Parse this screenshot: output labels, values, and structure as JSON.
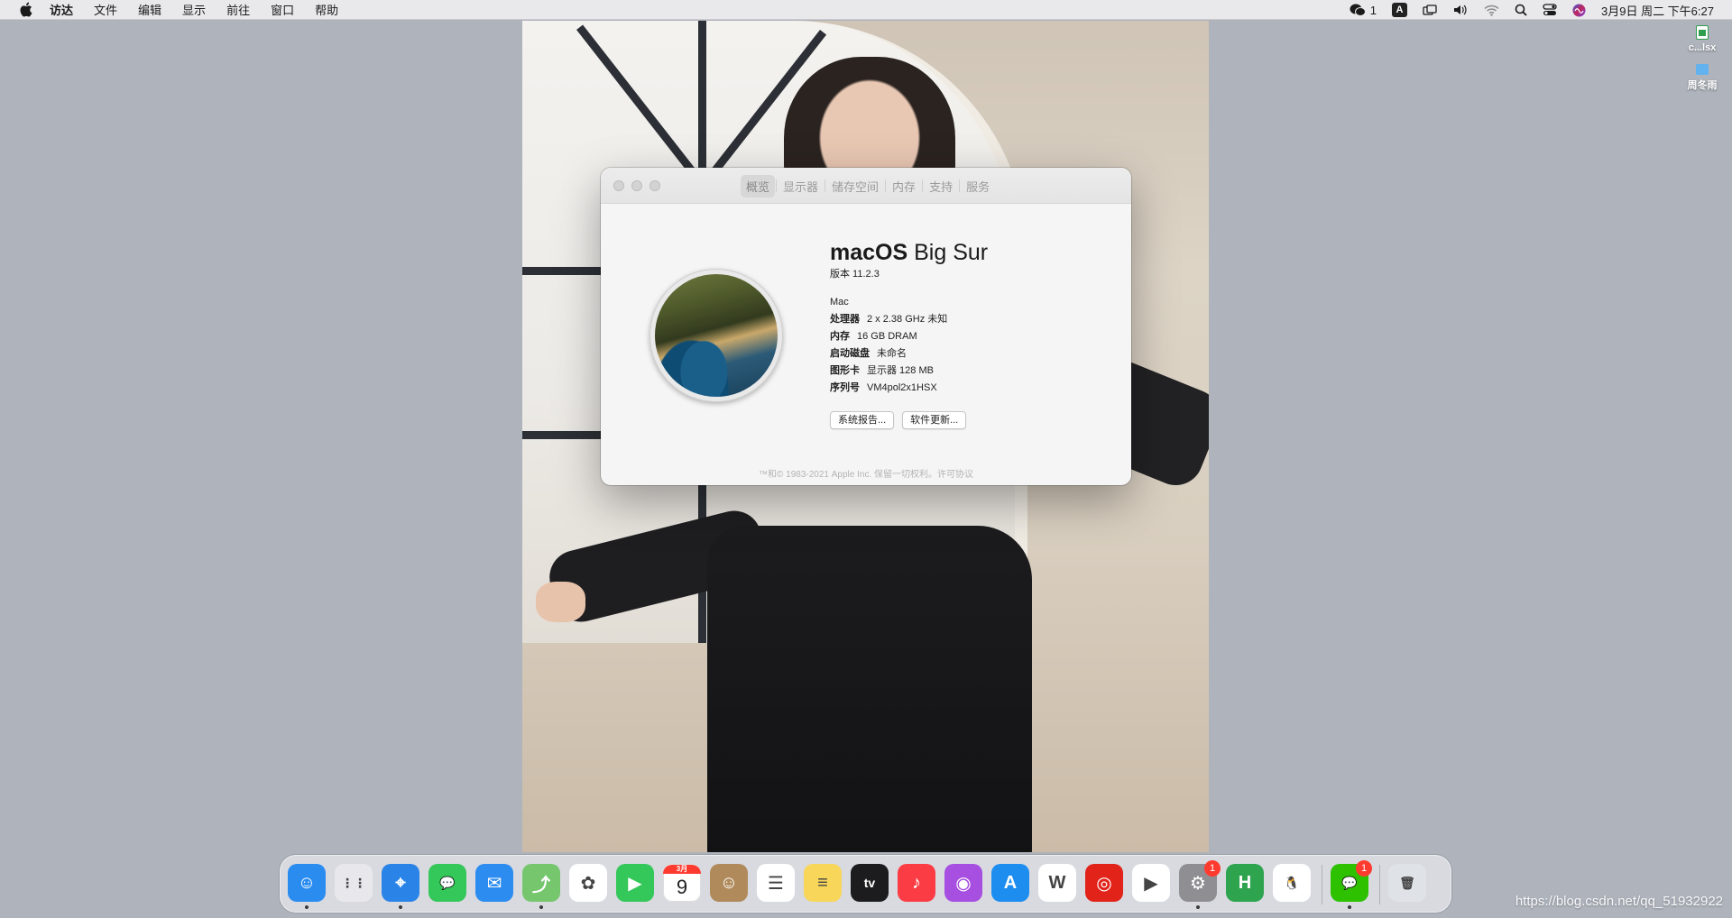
{
  "menubar": {
    "items": [
      "访达",
      "文件",
      "编辑",
      "显示",
      "前往",
      "窗口",
      "帮助"
    ],
    "wechat_count": "1",
    "input_method": "A",
    "datetime": "3月9日 周二 下午6:27"
  },
  "desktop": {
    "files": [
      {
        "label": "c...lsx",
        "icon": "spreadsheet-icon",
        "color": "#2f9e4f"
      },
      {
        "label": "周冬雨",
        "icon": "folder-icon",
        "color": "#62b2f0"
      }
    ]
  },
  "about_window": {
    "tabs": [
      "概览",
      "显示器",
      "储存空间",
      "内存",
      "支持",
      "服务"
    ],
    "os_name_bold": "macOS",
    "os_name_rest": " Big Sur",
    "version_label": "版本 11.2.3",
    "model": "Mac",
    "specs": [
      {
        "key": "处理器",
        "value": "2 x 2.38 GHz 未知"
      },
      {
        "key": "内存",
        "value": "16 GB DRAM"
      },
      {
        "key": "启动磁盘",
        "value": "未命名"
      },
      {
        "key": "图形卡",
        "value": "显示器 128 MB"
      },
      {
        "key": "序列号",
        "value": "VM4pol2x1HSX"
      }
    ],
    "buttons": {
      "system_report": "系统报告...",
      "software_update": "软件更新..."
    },
    "copyright": "™和© 1983-2021 Apple Inc. 保留一切权利。许可协议"
  },
  "dock": {
    "calendar_month": "3月",
    "calendar_day": "9",
    "settings_badge": "1",
    "wechat_badge": "1",
    "apps": [
      {
        "name": "finder",
        "icon": "finder-icon",
        "color": "#2b8cf0",
        "glyph": "☺"
      },
      {
        "name": "launchpad",
        "icon": "launchpad-icon",
        "color": "#e8e8ec",
        "glyph": "⋮⋮"
      },
      {
        "name": "safari",
        "icon": "safari-icon",
        "color": "#2a84e8",
        "glyph": "⌖"
      },
      {
        "name": "messages",
        "icon": "messages-icon",
        "color": "#34c759",
        "glyph": "💬"
      },
      {
        "name": "mail",
        "icon": "mail-icon",
        "color": "#2d8cf0",
        "glyph": "✉"
      },
      {
        "name": "maps",
        "icon": "maps-icon",
        "color": "#76c66e",
        "glyph": "⤴"
      },
      {
        "name": "photos",
        "icon": "photos-icon",
        "color": "#ffffff",
        "glyph": "✿"
      },
      {
        "name": "facetime",
        "icon": "facetime-icon",
        "color": "#34c759",
        "glyph": "▶"
      },
      {
        "name": "calendar",
        "icon": "calendar-icon",
        "color": "#ffffff",
        "glyph": ""
      },
      {
        "name": "contacts",
        "icon": "contacts-icon",
        "color": "#b08a5a",
        "glyph": "☺"
      },
      {
        "name": "reminders",
        "icon": "reminders-icon",
        "color": "#ffffff",
        "glyph": "☰"
      },
      {
        "name": "notes",
        "icon": "notes-icon",
        "color": "#f7d65a",
        "glyph": "≡"
      },
      {
        "name": "apple-tv",
        "icon": "appletv-icon",
        "color": "#1c1c1e",
        "glyph": "tv"
      },
      {
        "name": "music",
        "icon": "music-icon",
        "color": "#fc3c44",
        "glyph": "♪"
      },
      {
        "name": "podcasts",
        "icon": "podcasts-icon",
        "color": "#a64fe0",
        "glyph": "◉"
      },
      {
        "name": "app-store",
        "icon": "appstore-icon",
        "color": "#1d8df0",
        "glyph": "A"
      },
      {
        "name": "wps",
        "icon": "wps-icon",
        "color": "#ffffff",
        "glyph": "W"
      },
      {
        "name": "netease-music",
        "icon": "netease-music-icon",
        "color": "#e2231a",
        "glyph": "◎"
      },
      {
        "name": "infuse",
        "icon": "video-player-icon",
        "color": "#ffffff",
        "glyph": "▶"
      },
      {
        "name": "system-preferences",
        "icon": "gear-icon",
        "color": "#8e8e93",
        "glyph": "⚙"
      },
      {
        "name": "hbuilder",
        "icon": "hbuilder-icon",
        "color": "#2ea44f",
        "glyph": "H"
      },
      {
        "name": "qq",
        "icon": "qq-penguin-icon",
        "color": "#ffffff",
        "glyph": "🐧"
      },
      {
        "name": "wechat",
        "icon": "wechat-icon",
        "color": "#2dc100",
        "glyph": "💬"
      },
      {
        "name": "trash",
        "icon": "trash-icon",
        "color": "#dfe3e8",
        "glyph": "🗑"
      }
    ]
  },
  "watermark": "https://blog.csdn.net/qq_51932922"
}
